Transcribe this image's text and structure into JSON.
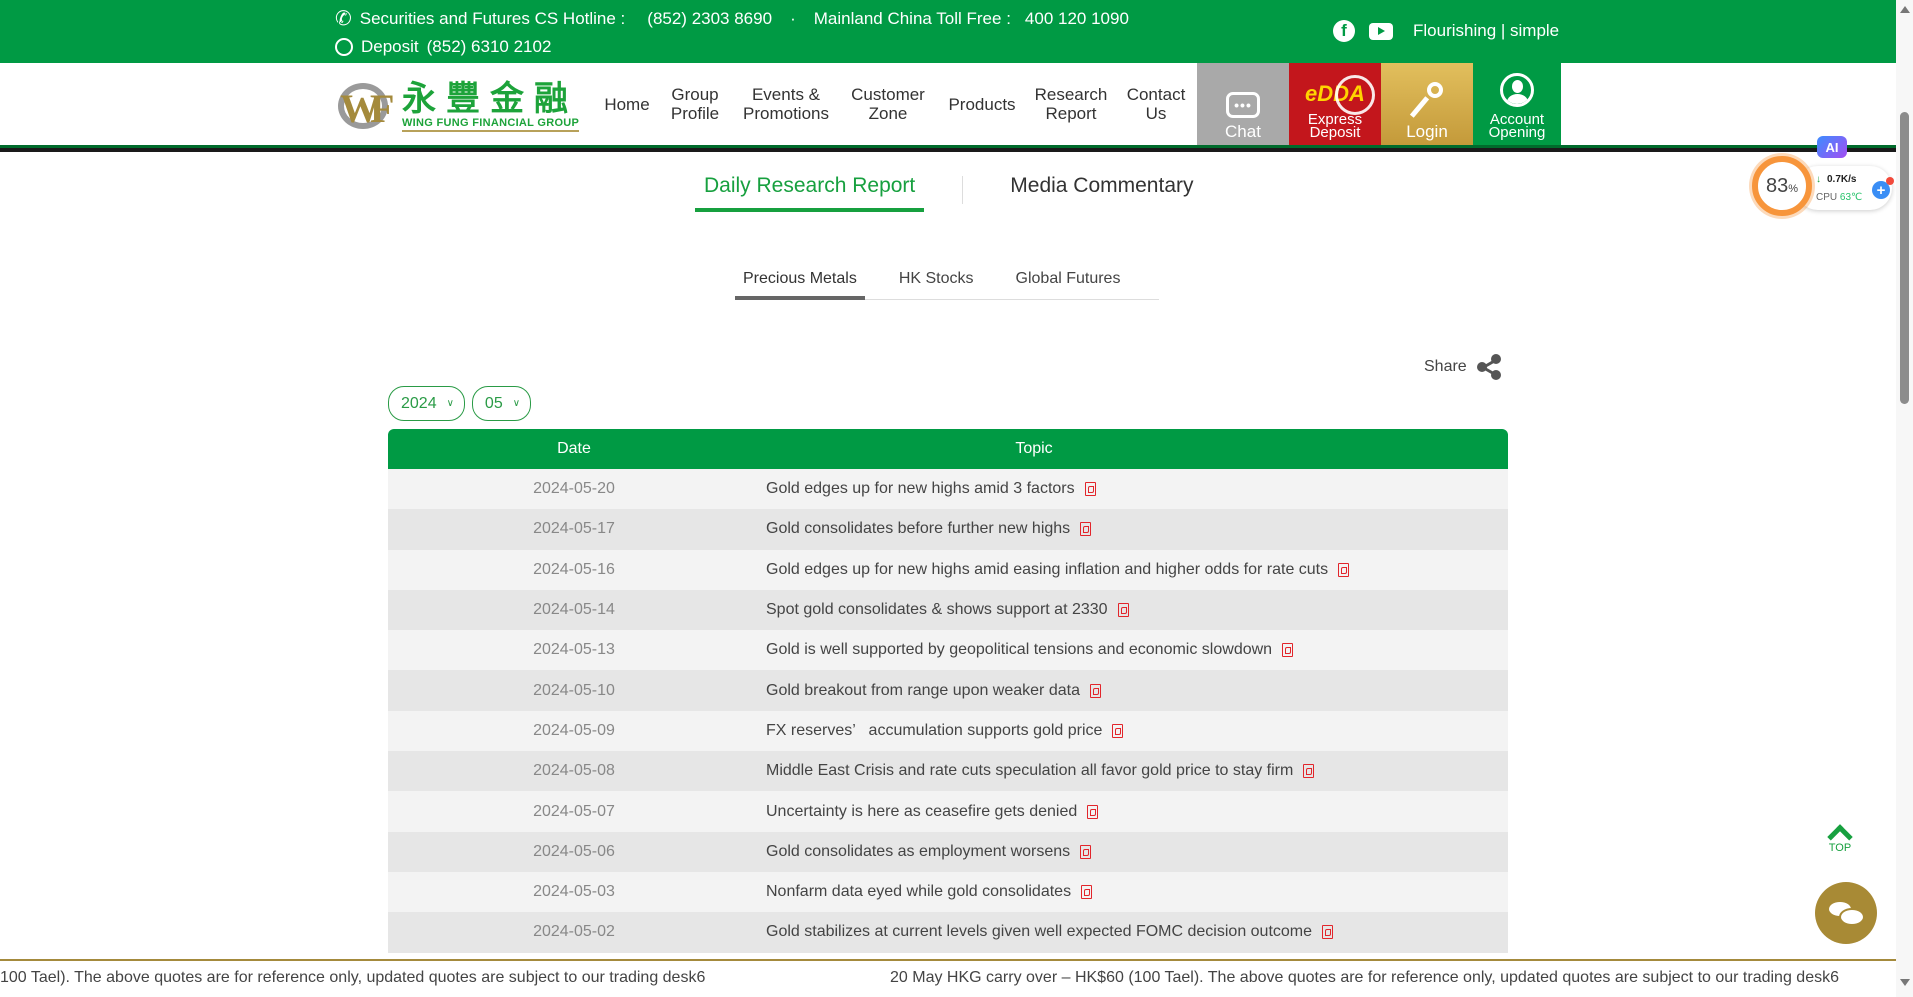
{
  "topbar": {
    "hotline_label": "Securities and Futures CS Hotline :",
    "hotline_number": "(852) 2303 8690",
    "separator": "·",
    "mainland_label": "Mainland China Toll Free :",
    "mainland_number": "400 120 1090",
    "deposit_label": "Deposit",
    "deposit_number": "(852) 6310 2102",
    "facebook_icon": "f",
    "language_links": "Flourishing | simple"
  },
  "brand": {
    "logo_mark": "WF",
    "name_cn": "永豐金融",
    "name_en": "WING FUNG FINANCIAL GROUP"
  },
  "nav": {
    "items": [
      {
        "line1": "Home",
        "line2": ""
      },
      {
        "line1": "Group",
        "line2": "Profile"
      },
      {
        "line1": "Events &",
        "line2": "Promotions"
      },
      {
        "line1": "Customer",
        "line2": "Zone"
      },
      {
        "line1": "Products",
        "line2": ""
      },
      {
        "line1": "Research",
        "line2": "Report"
      },
      {
        "line1": "Contact",
        "line2": "Us"
      }
    ],
    "chat": {
      "icon": "•••",
      "label": "Chat"
    },
    "edda": {
      "icon": "eDDA",
      "line1": "Express",
      "line2": "Deposit"
    },
    "login": {
      "label": "Login"
    },
    "account": {
      "line1": "Account",
      "line2": "Opening"
    }
  },
  "widget": {
    "ai_label": "AI",
    "cpu_usage": "83",
    "cpu_usage_unit": "%",
    "net_arrow": "↓",
    "net_speed": "0.7K/s",
    "cpu_label": "CPU",
    "cpu_temp": "63℃",
    "plus": "+"
  },
  "main_tabs": [
    {
      "label": "Daily Research Report",
      "active": true
    },
    {
      "label": "Media Commentary",
      "active": false
    }
  ],
  "sub_tabs": [
    {
      "label": "Precious Metals",
      "active": true
    },
    {
      "label": "HK Stocks",
      "active": false
    },
    {
      "label": "Global Futures",
      "active": false
    }
  ],
  "share_label": "Share",
  "filters": {
    "year": "2024",
    "month": "05",
    "chevron": "⌄"
  },
  "table": {
    "headers": {
      "date": "Date",
      "topic": "Topic"
    },
    "rows": [
      {
        "date": "2024-05-20",
        "topic": "Gold edges up for new highs amid 3 factors"
      },
      {
        "date": "2024-05-17",
        "topic": "Gold consolidates before further new highs"
      },
      {
        "date": "2024-05-16",
        "topic": "Gold edges up for new highs amid easing inflation and higher odds for rate cuts"
      },
      {
        "date": "2024-05-14",
        "topic": "Spot gold consolidates & shows support at 2330"
      },
      {
        "date": "2024-05-13",
        "topic": "Gold is well supported by geopolitical tensions and economic slowdown"
      },
      {
        "date": "2024-05-10",
        "topic": "Gold breakout from range upon weaker data"
      },
      {
        "date": "2024-05-09",
        "topic": "FX reserves’   accumulation supports gold price"
      },
      {
        "date": "2024-05-08",
        "topic": "Middle East Crisis and rate cuts speculation all favor gold price to stay firm"
      },
      {
        "date": "2024-05-07",
        "topic": "Uncertainty is here as ceasefire gets denied"
      },
      {
        "date": "2024-05-06",
        "topic": "Gold consolidates as employment worsens"
      },
      {
        "date": "2024-05-03",
        "topic": "Nonfarm data eyed while gold consolidates"
      },
      {
        "date": "2024-05-02",
        "topic": "Gold stabilizes at current levels given well expected FOMC decision outcome"
      }
    ]
  },
  "ticker": {
    "segment_a": "100 Tael). The above quotes are for reference only, updated quotes are subject to our trading desk6",
    "segment_b": "20 May HKG carry over – HK$60 (100 Tael). The above quotes are for reference only, updated quotes are subject to our trading desk6"
  },
  "floating": {
    "top_label": "TOP"
  },
  "colors": {
    "brand_green": "#009a44",
    "edda_red": "#c3161c",
    "login_gold": "#c49a3a",
    "chat_gray": "#a9a9a9",
    "pdf_red": "#e2252b",
    "cpu_orange": "#f7953b"
  }
}
